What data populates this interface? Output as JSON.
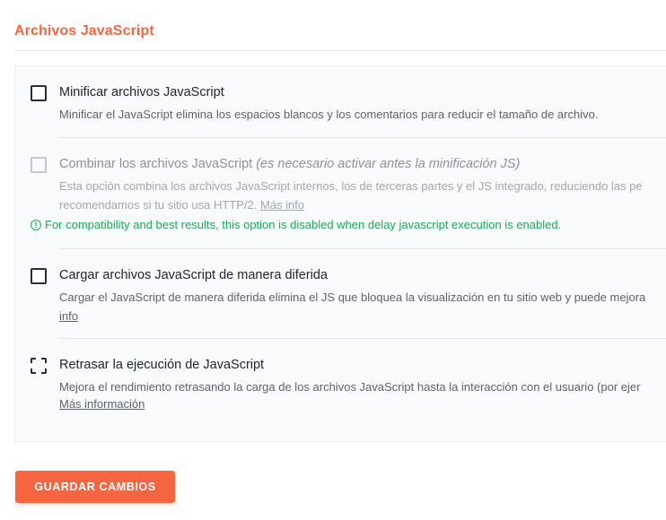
{
  "section": {
    "title": "Archivos JavaScript"
  },
  "options": [
    {
      "label": "Minificar archivos JavaScript",
      "checked": false,
      "disabled": false,
      "desc_line1": "Minificar el JavaScript elimina los espacios blancos y los comentarios para reducir el tamaño de archivo."
    },
    {
      "label": "Combinar los archivos JavaScript",
      "label_note": "(es necesario activar antes la minificación JS)",
      "checked": false,
      "disabled": true,
      "desc_line1": "Esta opción combina los archivos JavaScript internos, los de terceras partes y el JS integrado, reduciendo las pe",
      "desc_line2": "recomendamos si tu sitio usa HTTP/2.",
      "link": "Más info",
      "warning": "For compatibility and best results, this option is disabled when delay javascript execution is enabled."
    },
    {
      "label": "Cargar archivos JavaScript de manera diferida",
      "checked": false,
      "disabled": false,
      "desc_line1": "Cargar el JavaScript de manera diferida elimina el JS que bloquea la visualización en tu sitio web y puede mejora",
      "link": "info"
    },
    {
      "label": "Retrasar la ejecución de JavaScript",
      "checked": false,
      "disabled": false,
      "desc_line1": "Mejora el rendimiento retrasando la carga de los archivos JavaScript hasta la interacción con el usuario (por ejer",
      "link": "Más información"
    }
  ],
  "save_button": {
    "label": "GUARDAR CAMBIOS"
  },
  "colors": {
    "accent": "#f56640",
    "warning": "#1ea85a",
    "panel_bg": "#f9fafb"
  },
  "icons": {
    "warning": "info-circle-icon"
  }
}
